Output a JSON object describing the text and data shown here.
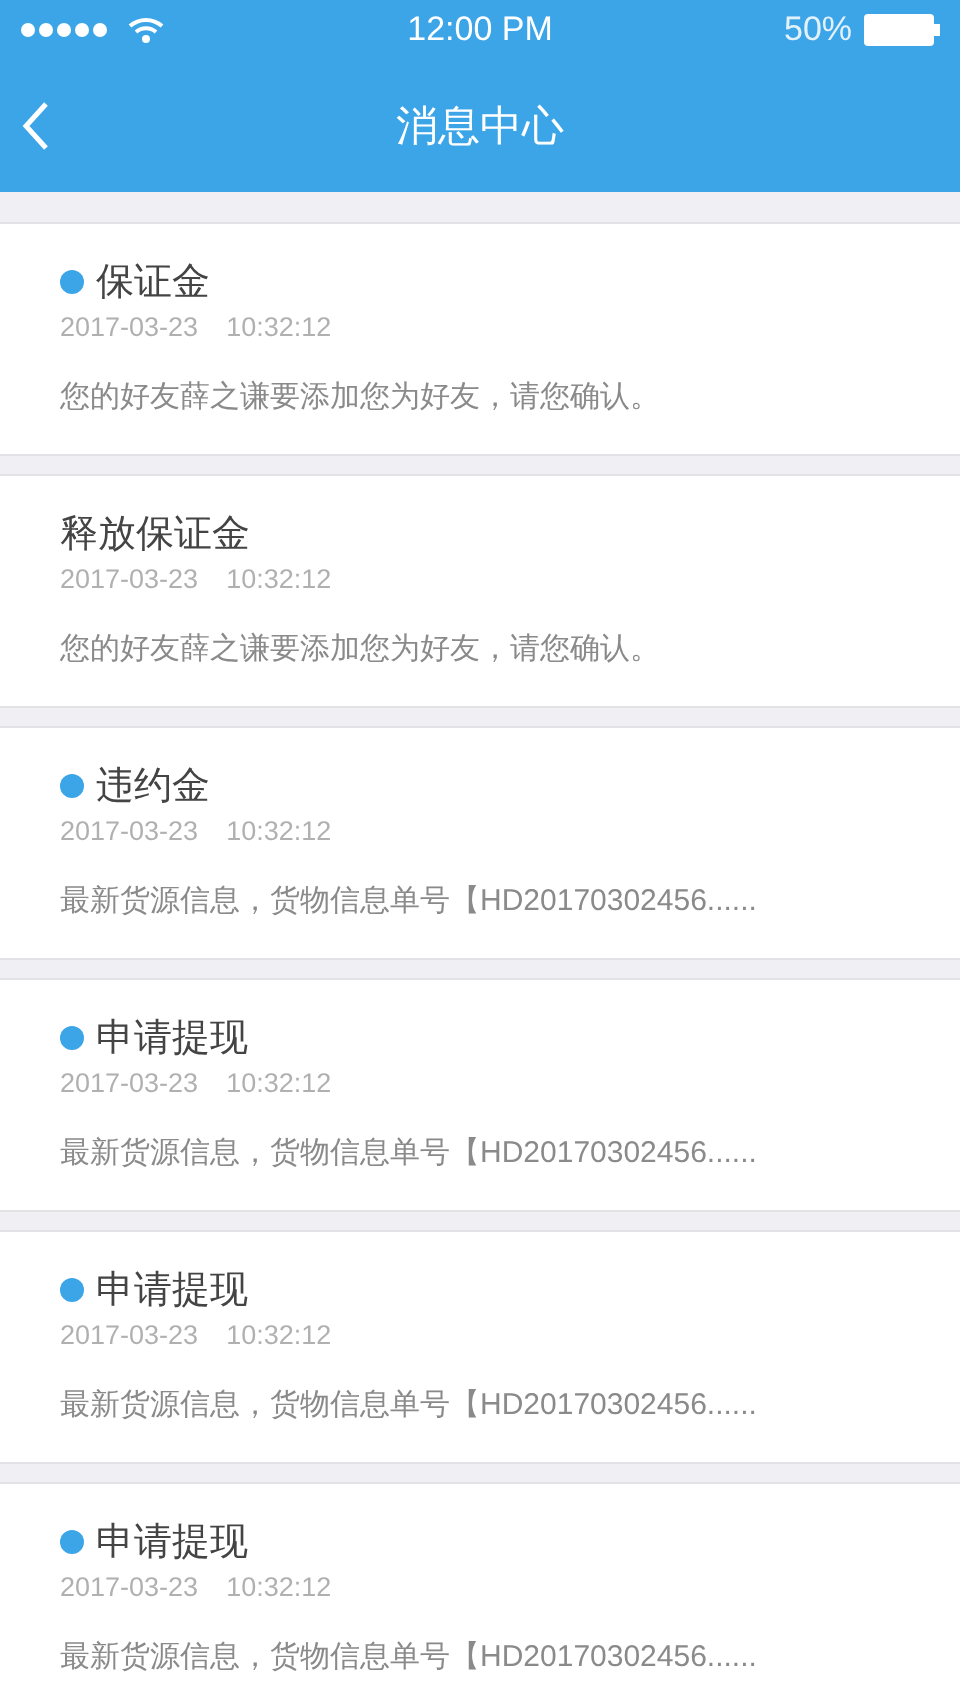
{
  "status_bar": {
    "time": "12:00 PM",
    "battery": "50%"
  },
  "nav": {
    "title": "消息中心"
  },
  "messages": [
    {
      "title": "保证金",
      "unread": true,
      "date": "2017-03-23",
      "time": "10:32:12",
      "text": "您的好友薛之谦要添加您为好友，请您确认。"
    },
    {
      "title": "释放保证金",
      "unread": false,
      "date": "2017-03-23",
      "time": "10:32:12",
      "text": "您的好友薛之谦要添加您为好友，请您确认。"
    },
    {
      "title": "违约金",
      "unread": true,
      "date": "2017-03-23",
      "time": "10:32:12",
      "text": "最新货源信息，货物信息单号【HD20170302456......"
    },
    {
      "title": "申请提现",
      "unread": true,
      "date": "2017-03-23",
      "time": "10:32:12",
      "text": "最新货源信息，货物信息单号【HD20170302456......"
    },
    {
      "title": "申请提现",
      "unread": true,
      "date": "2017-03-23",
      "time": "10:32:12",
      "text": "最新货源信息，货物信息单号【HD20170302456......"
    },
    {
      "title": "申请提现",
      "unread": true,
      "date": "2017-03-23",
      "time": "10:32:12",
      "text": "最新货源信息，货物信息单号【HD20170302456......"
    }
  ]
}
